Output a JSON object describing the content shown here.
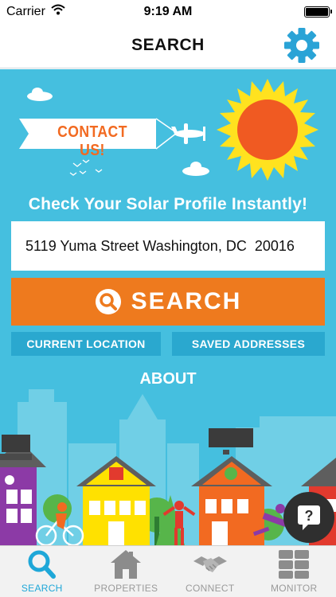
{
  "status_bar": {
    "carrier": "Carrier",
    "time": "9:19 AM"
  },
  "nav": {
    "title": "SEARCH",
    "settings_icon": "gear-icon"
  },
  "banner": {
    "text": "CONTACT US!"
  },
  "hero": {
    "headline": "Check Your Solar Profile Instantly!"
  },
  "search": {
    "address_value": "5119 Yuma Street Washington, DC  20016",
    "button_label": "SEARCH",
    "button_icon": "search-icon"
  },
  "links": {
    "current_location": "CURRENT LOCATION",
    "saved_addresses": "SAVED ADDRESSES",
    "about": "ABOUT"
  },
  "help": {
    "icon": "help-chat-icon",
    "symbol": "?"
  },
  "tabs": [
    {
      "label": "SEARCH",
      "icon": "search-icon",
      "active": true
    },
    {
      "label": "PROPERTIES",
      "icon": "house-icon",
      "active": false
    },
    {
      "label": "CONNECT",
      "icon": "handshake-icon",
      "active": false
    },
    {
      "label": "MONITOR",
      "icon": "solar-panel-icon",
      "active": false
    }
  ],
  "colors": {
    "sky": "#45bfdf",
    "accent_orange": "#ee7a1e",
    "chip_blue": "#2aa8cf",
    "tab_active": "#1ea7d8",
    "sun": "#f05a22",
    "sun_rays": "#ffe21f"
  }
}
